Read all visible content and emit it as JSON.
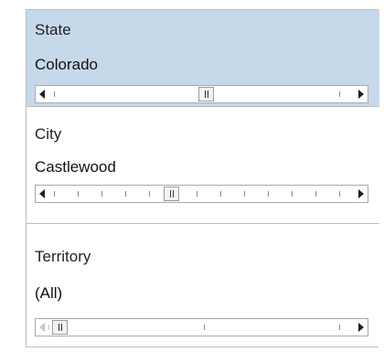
{
  "filters": [
    {
      "title": "State",
      "value": "Colorado",
      "selected": true,
      "slider_position": 0.5
    },
    {
      "title": "City",
      "value": "Castlewood",
      "selected": false,
      "slider_position": 0.4
    },
    {
      "title": "Territory",
      "value": "(All)",
      "selected": false,
      "slider_position": 0.0
    }
  ],
  "colors": {
    "selected_background": "#c6d9eb",
    "border": "#bfbfbf"
  }
}
